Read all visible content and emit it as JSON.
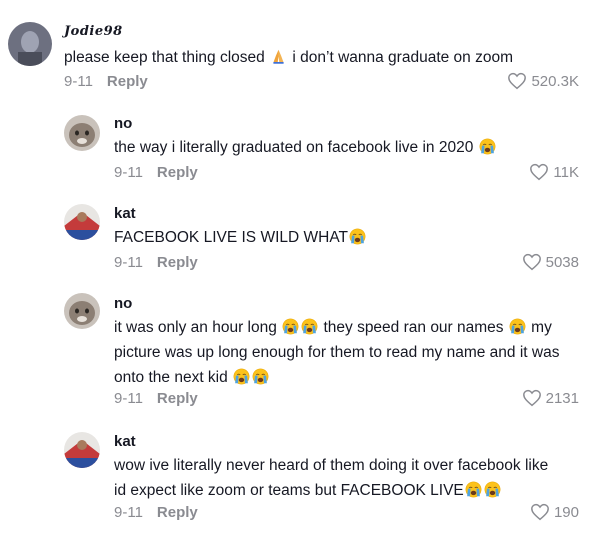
{
  "comments": [
    {
      "username": "Jodie98",
      "parts": [
        "please keep that thing closed ",
        " i don’t wanna graduate on zoom"
      ],
      "date": "9-11",
      "reply_label": "Reply",
      "likes": "520.3K"
    },
    {
      "username": "no",
      "parts": [
        "the way i literally graduated on facebook live in 2020 "
      ],
      "date": "9-11",
      "reply_label": "Reply",
      "likes": "11K"
    },
    {
      "username": "kat",
      "parts": [
        "FACEBOOK LIVE IS WILD WHAT"
      ],
      "date": "9-11",
      "reply_label": "Reply",
      "likes": "5038"
    },
    {
      "username": "no",
      "line1": [
        "it was only an hour long ",
        " they speed ran our names ",
        " my"
      ],
      "line2": "picture was up long enough for them to read my name and it was",
      "line3": "onto the next kid ",
      "date": "9-11",
      "reply_label": "Reply",
      "likes": "2131"
    },
    {
      "username": "kat",
      "line1": "wow ive literally never heard of them doing it over facebook like",
      "line2": "id expect like zoom or teams but FACEBOOK LIVE",
      "date": "9-11",
      "reply_label": "Reply",
      "likes": "190"
    }
  ],
  "icons": {
    "pray": "pray-emoji-icon",
    "crying": "loudly-crying-emoji-icon",
    "heart": "heart-outline-icon"
  },
  "colors": {
    "text": "#161823",
    "secondary": "#8a8b91",
    "emoji_face": "#fcc21b",
    "emoji_tears": "#4fa3e0"
  }
}
